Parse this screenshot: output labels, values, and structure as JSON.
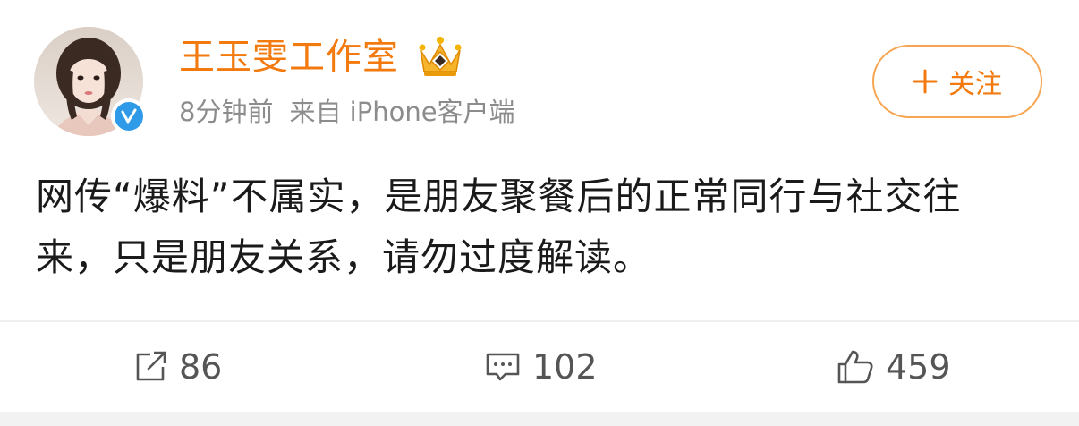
{
  "post": {
    "author": {
      "name": "王玉雯工作室",
      "avatar_icon": "profile-photo",
      "verified_icon": "verified-checkmark-icon",
      "crown_icon": "gold-crown-icon"
    },
    "meta": {
      "time": "8分钟前",
      "source": "来自 iPhone客户端"
    },
    "follow_button": {
      "label": "关注",
      "icon": "plus-icon"
    },
    "text": {
      "line1": "网传“爆料”不属实，是朋友聚餐后的正常同行与社交往",
      "line2": "来，只是朋友关系，请勿过度解读。"
    },
    "actions": {
      "repost": {
        "icon": "repost-icon",
        "count": "86"
      },
      "comment": {
        "icon": "comment-icon",
        "count": "102"
      },
      "like": {
        "icon": "thumbs-up-icon",
        "count": "459"
      }
    }
  },
  "colors": {
    "accent": "#f27a0e",
    "verified": "#2f9be8",
    "meta_text": "#8c8c8c",
    "body_text": "#1a1a1a",
    "action_text": "#555555"
  }
}
